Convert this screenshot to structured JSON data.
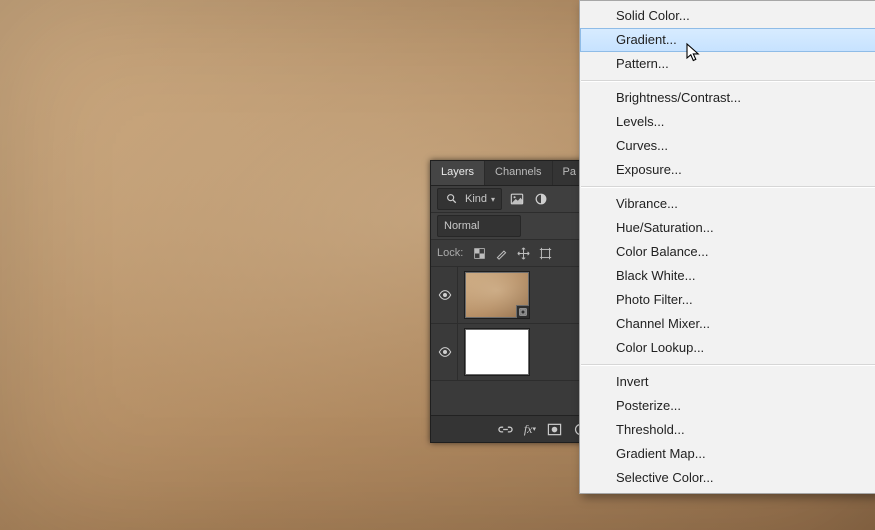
{
  "panel": {
    "tabs": [
      {
        "label": "Layers",
        "active": true
      },
      {
        "label": "Channels",
        "active": false
      },
      {
        "label": "Paths",
        "active": false
      }
    ],
    "filter": {
      "search_icon": "search-icon",
      "label": "Kind",
      "icon_names": [
        "image-filter-icon",
        "adjustment-filter-icon"
      ]
    },
    "blend_mode": "Normal",
    "lock": {
      "label": "Lock:",
      "icons": [
        "lock-transparency-icon",
        "lock-brush-icon",
        "lock-position-icon",
        "lock-artboard-icon"
      ]
    },
    "layers": [
      {
        "kind": "smart-object",
        "visible": true,
        "thumb": "leather"
      },
      {
        "kind": "pixel",
        "visible": true,
        "thumb": "white"
      }
    ],
    "bottom_icons": [
      "link-icon",
      "fx-icon",
      "mask-icon",
      "adjustment-icon",
      "group-icon",
      "new-layer-icon",
      "trash-icon"
    ]
  },
  "menu": {
    "groups": [
      [
        {
          "label": "Solid Color..."
        },
        {
          "label": "Gradient...",
          "highlight": true
        },
        {
          "label": "Pattern..."
        }
      ],
      [
        {
          "label": "Brightness/Contrast..."
        },
        {
          "label": "Levels..."
        },
        {
          "label": "Curves..."
        },
        {
          "label": "Exposure..."
        }
      ],
      [
        {
          "label": "Vibrance..."
        },
        {
          "label": "Hue/Saturation..."
        },
        {
          "label": "Color Balance..."
        },
        {
          "label": "Black  White..."
        },
        {
          "label": "Photo Filter..."
        },
        {
          "label": "Channel Mixer..."
        },
        {
          "label": "Color Lookup..."
        }
      ],
      [
        {
          "label": "Invert"
        },
        {
          "label": "Posterize..."
        },
        {
          "label": "Threshold..."
        },
        {
          "label": "Gradient Map..."
        },
        {
          "label": "Selective Color..."
        }
      ]
    ]
  }
}
